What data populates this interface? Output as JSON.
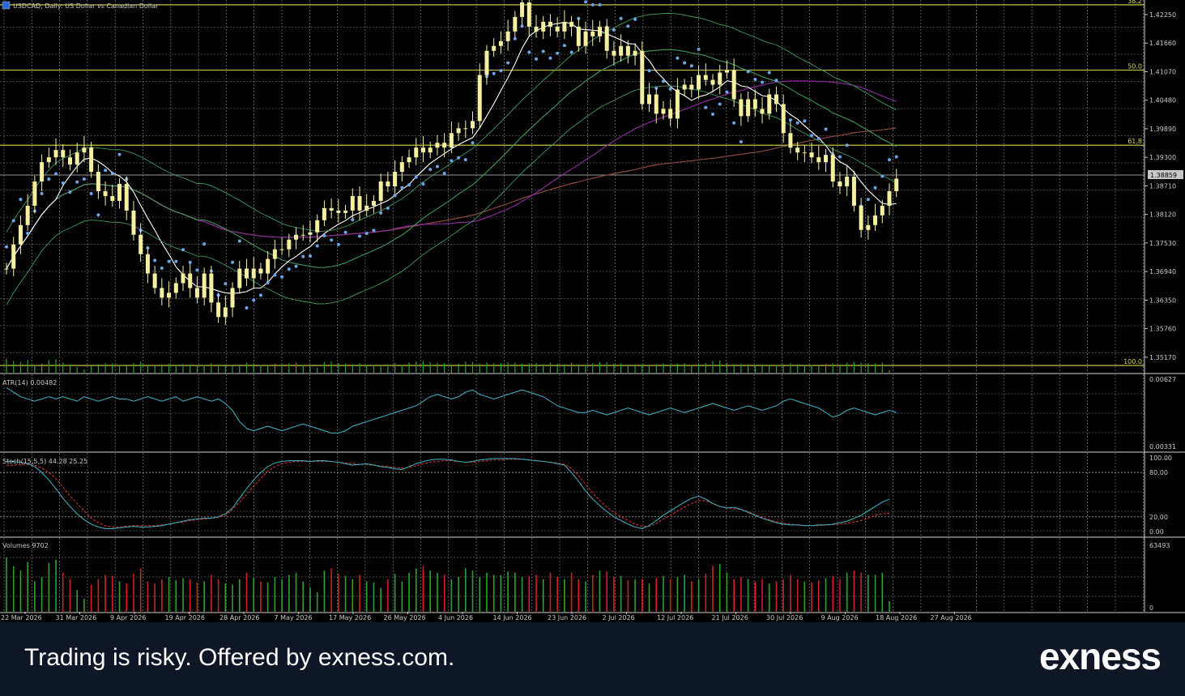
{
  "symbol_title": "USDCAD, Daily:  US Dollar vs Canadian Dollar",
  "current_price": "1.38859",
  "footer": {
    "disclaimer": "Trading is risky. Offered by exness.com.",
    "logo": "exness"
  },
  "colors": {
    "background": "#000000",
    "grid": "#8a8a8a",
    "candle": "#f5f0a0",
    "fib_line": "#d8d850",
    "psar": "#6aa6e8",
    "ma_white": "#ffffff",
    "ma_green": "#3c9a5a",
    "ma_brown": "#8a4a3a",
    "ma_purple": "#8a2a9a",
    "atr_line": "#3aa8b8",
    "stoch_main": "#3aa8b8",
    "stoch_signal": "#d03030",
    "volume_up": "#2ea02e",
    "volume_down": "#d02020",
    "footer_bg": "#0f1726"
  },
  "chart_data": [
    {
      "type": "candlestick",
      "title": "USDCAD, Daily:  US Dollar vs Canadian Dollar",
      "price_axis_ticks": [
        "1.42250",
        "1.41660",
        "1.41070",
        "1.40480",
        "1.39890",
        "1.39300",
        "1.38710",
        "1.38120",
        "1.37530",
        "1.36940",
        "1.36350",
        "1.35760",
        "1.35170"
      ],
      "ylim": [
        1.3485,
        1.4255
      ],
      "x_ticks": [
        "22 Mar 2026",
        "31 Mar 2026",
        "9 Apr 2026",
        "19 Apr 2026",
        "28 Apr 2026",
        "7 May 2026",
        "17 May 2026",
        "26 May 2026",
        "4 Jun 2026",
        "14 Jun 2026",
        "23 Jun 2026",
        "2 Jul 2026",
        "12 Jul 2026",
        "21 Jul 2026",
        "30 Jul 2026",
        "9 Aug 2026",
        "18 Aug 2026",
        "27 Aug 2026"
      ],
      "fibonacci_levels": [
        {
          "label": "38.2",
          "price": 1.4245
        },
        {
          "label": "50.0",
          "price": 1.411
        },
        {
          "label": "61.8",
          "price": 1.3955
        },
        {
          "label": "100.0",
          "price": 1.35
        }
      ],
      "close": [
        1.37,
        1.375,
        1.379,
        1.383,
        1.388,
        1.392,
        1.393,
        1.3945,
        1.393,
        1.3915,
        1.394,
        1.395,
        1.39,
        1.386,
        1.385,
        1.384,
        1.3875,
        1.382,
        1.377,
        1.373,
        1.369,
        1.366,
        1.364,
        1.365,
        1.367,
        1.369,
        1.366,
        1.364,
        1.369,
        1.363,
        1.36,
        1.362,
        1.366,
        1.37,
        1.368,
        1.37,
        1.369,
        1.372,
        1.374,
        1.374,
        1.376,
        1.377,
        1.377,
        1.3775,
        1.38,
        1.3825,
        1.382,
        1.3815,
        1.382,
        1.385,
        1.382,
        1.383,
        1.384,
        1.388,
        1.387,
        1.39,
        1.392,
        1.393,
        1.395,
        1.394,
        1.395,
        1.396,
        1.395,
        1.398,
        1.399,
        1.399,
        1.4005,
        1.41,
        1.415,
        1.416,
        1.417,
        1.419,
        1.422,
        1.425,
        1.42,
        1.419,
        1.421,
        1.42,
        1.419,
        1.421,
        1.42,
        1.416,
        1.419,
        1.418,
        1.42,
        1.415,
        1.414,
        1.416,
        1.414,
        1.415,
        1.404,
        1.406,
        1.402,
        1.403,
        1.401,
        1.407,
        1.408,
        1.407,
        1.41,
        1.409,
        1.408,
        1.4105,
        1.411,
        1.405,
        1.4015,
        1.405,
        1.403,
        1.402,
        1.406,
        1.404,
        1.398,
        1.395,
        1.394,
        1.394,
        1.393,
        1.392,
        1.3935,
        1.388,
        1.387,
        1.389,
        1.383,
        1.378,
        1.379,
        1.381,
        1.383,
        1.386,
        1.3886
      ],
      "overlays": [
        "parabolic-sar",
        "moving-average-white",
        "moving-average-green",
        "moving-average-brown",
        "moving-average-purple",
        "bollinger-band-green"
      ]
    },
    {
      "type": "line",
      "title": "ATR(14) 0.00482",
      "ylim": [
        0.00331,
        0.00627
      ],
      "axis_ticks": [
        "0.00627",
        "0.00331"
      ],
      "series": [
        {
          "name": "ATR(14)",
          "values": [
            0.0059,
            0.0057,
            0.0055,
            0.0054,
            0.0053,
            0.0054,
            0.0055,
            0.0054,
            0.0055,
            0.0054,
            0.0053,
            0.0055,
            0.0054,
            0.0053,
            0.0054,
            0.0055,
            0.0054,
            0.0054,
            0.0053,
            0.0054,
            0.0055,
            0.0054,
            0.0053,
            0.0054,
            0.0055,
            0.0053,
            0.0054,
            0.0055,
            0.0054,
            0.0053,
            0.0054,
            0.0052,
            0.0049,
            0.0044,
            0.0041,
            0.004,
            0.0041,
            0.0042,
            0.0041,
            0.004,
            0.0041,
            0.0042,
            0.0043,
            0.0042,
            0.0041,
            0.004,
            0.0039,
            0.0039,
            0.004,
            0.0042,
            0.0043,
            0.0044,
            0.0045,
            0.0046,
            0.0047,
            0.0048,
            0.0049,
            0.005,
            0.0051,
            0.0053,
            0.0055,
            0.0056,
            0.0055,
            0.0054,
            0.0055,
            0.0057,
            0.0058,
            0.0056,
            0.0055,
            0.0054,
            0.0055,
            0.0056,
            0.0057,
            0.0058,
            0.0057,
            0.0056,
            0.0055,
            0.0053,
            0.0051,
            0.005,
            0.0049,
            0.0048,
            0.0048,
            0.0049,
            0.0048,
            0.0047,
            0.0048,
            0.0049,
            0.005,
            0.0049,
            0.0048,
            0.0047,
            0.0048,
            0.0049,
            0.005,
            0.0049,
            0.0048,
            0.0049,
            0.005,
            0.0051,
            0.0052,
            0.0051,
            0.005,
            0.0049,
            0.005,
            0.0051,
            0.005,
            0.0049,
            0.005,
            0.0051,
            0.0053,
            0.0054,
            0.0053,
            0.0052,
            0.0051,
            0.005,
            0.0048,
            0.0046,
            0.0047,
            0.0049,
            0.005,
            0.0049,
            0.0048,
            0.0047,
            0.0048,
            0.0049,
            0.0048
          ]
        }
      ]
    },
    {
      "type": "line",
      "title": "Stoch(15,5,5) 44.28 25.25",
      "ylim": [
        0,
        100
      ],
      "axis_ticks": [
        "100.00",
        "80.00",
        "20.00",
        "0.00"
      ],
      "series": [
        {
          "name": "Stoch main",
          "values": [
            95,
            95,
            94,
            92,
            88,
            80,
            70,
            58,
            45,
            34,
            24,
            16,
            10,
            6,
            4,
            4,
            5,
            6,
            7,
            6,
            6,
            7,
            8,
            10,
            12,
            14,
            16,
            17,
            18,
            18,
            20,
            24,
            32,
            45,
            58,
            70,
            80,
            88,
            93,
            95,
            96,
            96,
            96,
            95,
            96,
            96,
            95,
            94,
            92,
            90,
            91,
            92,
            90,
            88,
            87,
            85,
            84,
            88,
            92,
            95,
            97,
            98,
            98,
            97,
            95,
            94,
            95,
            97,
            98,
            99,
            99,
            99,
            99,
            98,
            97,
            96,
            95,
            94,
            92,
            90,
            80,
            68,
            55,
            44,
            35,
            27,
            20,
            15,
            10,
            6,
            4,
            8,
            15,
            22,
            28,
            34,
            40,
            45,
            48,
            44,
            38,
            34,
            32,
            33,
            30,
            26,
            22,
            18,
            15,
            12,
            10,
            9,
            9,
            8,
            8,
            9,
            9,
            10,
            12,
            14,
            18,
            22,
            28,
            34,
            40,
            44
          ]
        },
        {
          "name": "Stoch signal",
          "values": [
            90,
            90,
            91,
            91,
            90,
            86,
            80,
            72,
            60,
            48,
            38,
            28,
            18,
            12,
            8,
            6,
            6,
            7,
            8,
            8,
            8,
            8,
            9,
            10,
            12,
            13,
            15,
            16,
            17,
            18,
            19,
            22,
            30,
            40,
            50,
            62,
            72,
            82,
            88,
            92,
            94,
            95,
            95,
            95,
            95,
            95,
            95,
            94,
            93,
            92,
            91,
            91,
            90,
            89,
            88,
            87,
            86,
            87,
            89,
            92,
            94,
            95,
            96,
            96,
            95,
            94,
            94,
            95,
            96,
            97,
            97,
            98,
            98,
            98,
            97,
            96,
            95,
            94,
            93,
            91,
            86,
            76,
            64,
            52,
            42,
            33,
            26,
            20,
            15,
            10,
            7,
            7,
            11,
            17,
            22,
            28,
            33,
            38,
            42,
            42,
            38,
            34,
            32,
            31,
            30,
            27,
            23,
            19,
            16,
            13,
            11,
            10,
            9,
            8,
            8,
            8,
            9,
            9,
            10,
            11,
            13,
            15,
            18,
            22,
            24,
            25
          ]
        }
      ]
    },
    {
      "type": "bar",
      "title": "Volumes 9702",
      "ylim": [
        0,
        63493
      ],
      "axis_ticks": [
        "63493",
        "0"
      ],
      "series": [
        {
          "name": "Volumes",
          "values": [
            50000,
            42000,
            38000,
            46000,
            28000,
            32000,
            45000,
            48000,
            36000,
            30000,
            20000,
            12000,
            25000,
            30000,
            34000,
            33000,
            28000,
            26000,
            35000,
            40000,
            28000,
            26000,
            30000,
            32000,
            29000,
            31000,
            30000,
            27000,
            28000,
            34000,
            30000,
            26000,
            25000,
            30000,
            36000,
            31000,
            28000,
            27000,
            32000,
            30000,
            34000,
            36000,
            28000,
            22000,
            18000,
            38000,
            40000,
            35000,
            33000,
            30000,
            34000,
            28000,
            27000,
            22000,
            30000,
            35000,
            28000,
            36000,
            40000,
            42000,
            38000,
            36000,
            34000,
            30000,
            32000,
            40000,
            38000,
            32000,
            36000,
            34000,
            34000,
            37000,
            36000,
            32000,
            33000,
            34000,
            30000,
            36000,
            32000,
            30000,
            36000,
            30000,
            28000,
            34000,
            38000,
            37000,
            32000,
            33000,
            29000,
            30000,
            30000,
            26000,
            31000,
            33000,
            30000,
            32000,
            34000,
            28000,
            30000,
            35000,
            42000,
            44000,
            36000,
            30000,
            32000,
            30000,
            28000,
            30000,
            26000,
            28000,
            30000,
            34000,
            30000,
            28000,
            27000,
            29000,
            31000,
            33000,
            30000,
            36000,
            38000,
            36000,
            34000,
            34000,
            36000,
            9702
          ]
        }
      ]
    }
  ]
}
